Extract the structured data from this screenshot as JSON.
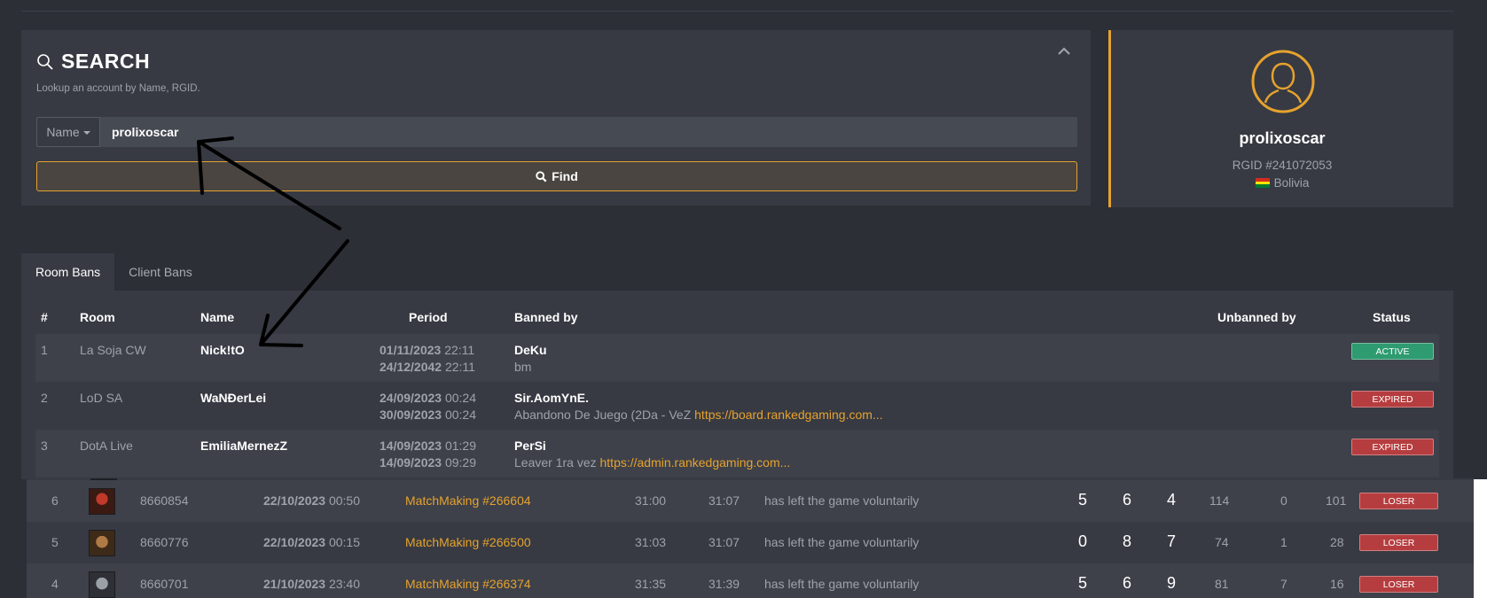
{
  "search": {
    "title": "SEARCH",
    "subtitle": "Lookup an account by Name, RGID.",
    "selector_label": "Name",
    "input_value": "prolixoscar",
    "find_label": "Find"
  },
  "profile": {
    "name": "prolixoscar",
    "rgid": "RGID #241072053",
    "country": "Bolivia"
  },
  "tabs": [
    {
      "label": "Room Bans",
      "active": true
    },
    {
      "label": "Client Bans",
      "active": false
    }
  ],
  "bans": {
    "headers": {
      "num": "#",
      "room": "Room",
      "name": "Name",
      "period": "Period",
      "banned_by": "Banned by",
      "unbanned_by": "Unbanned by",
      "status": "Status"
    },
    "rows": [
      {
        "num": "1",
        "room": "La Soja CW",
        "name": "Nick!tO",
        "start_date": "01/11/2023",
        "start_time": "22:11",
        "end_date": "24/12/2042",
        "end_time": "22:11",
        "banned_by": "DeKu",
        "reason": "bm",
        "reason_link": "",
        "status": "ACTIVE"
      },
      {
        "num": "2",
        "room": "LoD SA",
        "name": "WaNĐerLei",
        "start_date": "24/09/2023",
        "start_time": "00:24",
        "end_date": "30/09/2023",
        "end_time": "00:24",
        "banned_by": "Sir.AomYnE.",
        "reason": "Abandono De Juego (2Da - VeZ ",
        "reason_link": "https://board.rankedgaming.com...",
        "status": "EXPIRED"
      },
      {
        "num": "3",
        "room": "DotA Live",
        "name": "EmiliaMernezZ",
        "start_date": "14/09/2023",
        "start_time": "01:29",
        "end_date": "14/09/2023",
        "end_time": "09:29",
        "banned_by": "PerSi",
        "reason": "Leaver 1ra vez ",
        "reason_link": "https://admin.rankedgaming.com...",
        "status": "EXPIRED"
      }
    ]
  },
  "matches": [
    {
      "num": "6",
      "hero_icon": "hero-red-portrait",
      "id": "8660854",
      "date": "22/10/2023",
      "time": "00:50",
      "game": "MatchMaking #266604",
      "t1": "31:00",
      "t2": "31:07",
      "reason": "has left the game voluntarily",
      "k": "5",
      "d": "6",
      "a": "4",
      "cs": "114",
      "dn": "0",
      "n": "101",
      "result": "LOSER"
    },
    {
      "num": "5",
      "hero_icon": "hero-brown-portrait",
      "id": "8660776",
      "date": "22/10/2023",
      "time": "00:15",
      "game": "MatchMaking #266500",
      "t1": "31:03",
      "t2": "31:07",
      "reason": "has left the game voluntarily",
      "k": "0",
      "d": "8",
      "a": "7",
      "cs": "74",
      "dn": "1",
      "n": "28",
      "result": "LOSER"
    },
    {
      "num": "4",
      "hero_icon": "hero-grey-portrait",
      "id": "8660701",
      "date": "21/10/2023",
      "time": "23:40",
      "game": "MatchMaking #266374",
      "t1": "31:35",
      "t2": "31:39",
      "reason": "has left the game voluntarily",
      "k": "5",
      "d": "6",
      "a": "9",
      "cs": "81",
      "dn": "7",
      "n": "16",
      "result": "LOSER"
    }
  ],
  "colors": {
    "accent": "#e6a22e",
    "active": "#2e9b70",
    "expired": "#b63d3f",
    "panel": "#373a42"
  }
}
